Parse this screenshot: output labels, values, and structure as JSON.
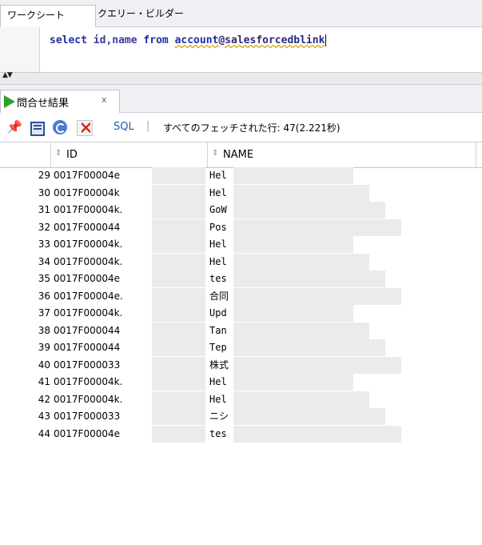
{
  "tabs": [
    {
      "label": "ワークシート"
    },
    {
      "label": "クエリー・ビルダー"
    }
  ],
  "editor": {
    "kw_select": "select",
    "cols": "id,name",
    "kw_from": "from",
    "tbl": "account",
    "db": "@salesforcedblink"
  },
  "results_tab": {
    "label": "問合せ結果",
    "close": "x"
  },
  "toolbar": {
    "sql_label": "SQL",
    "separator": "|",
    "status": "すべてのフェッチされた行: 47(2.221秒)"
  },
  "grid": {
    "columns": [
      "ID",
      "NAME"
    ],
    "rows": [
      {
        "n": "29",
        "id": "0017F00004e",
        "name": "Hel"
      },
      {
        "n": "30",
        "id": "0017F00004k",
        "name": "Hel"
      },
      {
        "n": "31",
        "id": "0017F00004k.",
        "name": "GoW"
      },
      {
        "n": "32",
        "id": "0017F000044",
        "name": "Pos"
      },
      {
        "n": "33",
        "id": "0017F00004k.",
        "name": "Hel"
      },
      {
        "n": "34",
        "id": "0017F00004k.",
        "name": "Hel"
      },
      {
        "n": "35",
        "id": "0017F00004e",
        "name": "tes"
      },
      {
        "n": "36",
        "id": "0017F00004e.",
        "name": "合同"
      },
      {
        "n": "37",
        "id": "0017F00004k.",
        "name": "Upd"
      },
      {
        "n": "38",
        "id": "0017F000044",
        "name": "Tan"
      },
      {
        "n": "39",
        "id": "0017F000044",
        "name": "Tep"
      },
      {
        "n": "40",
        "id": "0017F000033",
        "name": "株式"
      },
      {
        "n": "41",
        "id": "0017F00004k.",
        "name": "Hel"
      },
      {
        "n": "42",
        "id": "0017F00004k.",
        "name": "Hel"
      },
      {
        "n": "43",
        "id": "0017F000033",
        "name": "ニシ"
      },
      {
        "n": "44",
        "id": "0017F00004e",
        "name": "tes"
      }
    ]
  }
}
